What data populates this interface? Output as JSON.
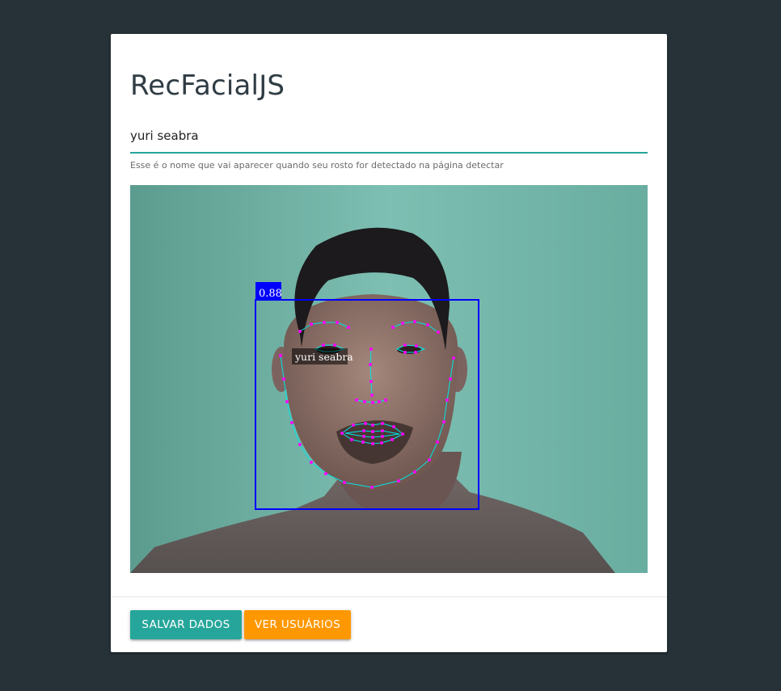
{
  "app": {
    "title": "RecFacialJS"
  },
  "form": {
    "name_value": "yuri seabra",
    "helper_text": "Esse é o nome que vai aparecer quando seu rosto for detectado na página detectar"
  },
  "camera": {
    "detection_score": "0.88",
    "face_label": "yuri seabra"
  },
  "actions": {
    "save_label": "SALVAR DADOS",
    "users_label": "VER USUÁRIOS"
  },
  "colors": {
    "background": "#263238",
    "accent_teal": "#26a69a",
    "accent_orange": "#ff9800",
    "detection_box": "#0000ff",
    "landmark_line": "#00e5e5",
    "landmark_point": "#ff00ff"
  }
}
